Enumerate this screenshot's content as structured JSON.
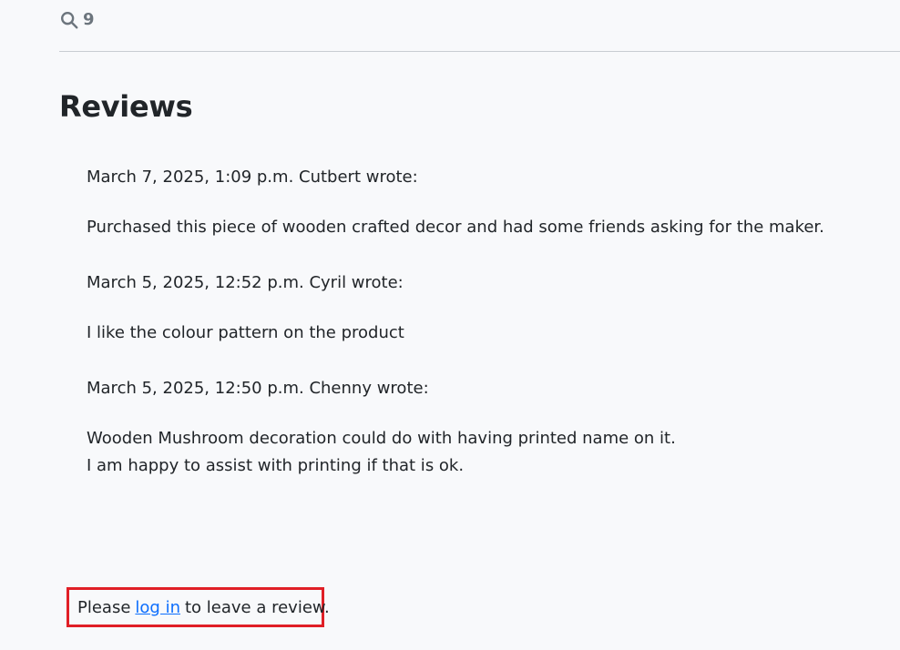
{
  "header": {
    "search_icon": "search-icon",
    "count": "9"
  },
  "page": {
    "title": "Reviews"
  },
  "reviews": [
    {
      "meta": "March 7, 2025, 1:09 p.m. Cutbert wrote:",
      "body": "Purchased this piece of wooden crafted decor and had some friends asking for the maker."
    },
    {
      "meta": "March 5, 2025, 12:52 p.m. Cyril wrote:",
      "body": "I like the colour pattern on the product"
    },
    {
      "meta": "March 5, 2025, 12:50 p.m. Chenny wrote:",
      "body": "Wooden Mushroom decoration could do with having printed name on it.\nI am happy to assist with printing if that is ok."
    }
  ],
  "login_prompt": {
    "prefix": "Please",
    "link_text": "log in",
    "suffix": "to leave a review."
  },
  "colors": {
    "background": "#f8f9fb",
    "text": "#212529",
    "muted": "#6c757d",
    "link": "#0d6efd",
    "highlight_border": "#e01f26"
  }
}
